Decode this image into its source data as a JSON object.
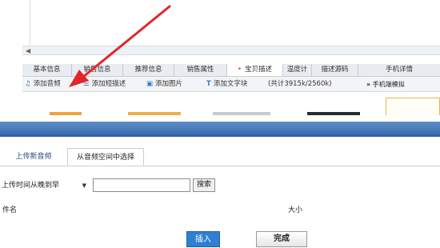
{
  "editor": {
    "tabs": [
      {
        "label": "基本信息",
        "required": false
      },
      {
        "label": "销售信息",
        "required": false
      },
      {
        "label": "推荐信息",
        "required": false
      },
      {
        "label": "销售属性",
        "required": false
      },
      {
        "label": "宝贝描述",
        "required": true
      },
      {
        "label": "温度计",
        "required": false
      },
      {
        "label": "描述源码",
        "required": false
      },
      {
        "label": "手机详情",
        "required": false
      }
    ],
    "toolbar": {
      "add_audio": "添加音频",
      "add_short_desc": "添加短描述",
      "add_image": "添加图片",
      "add_text": "添加文字块",
      "count": "(共计3915k/2560k)",
      "mobile_preview": "手机端模拟"
    },
    "icons": {
      "audio": "music-note-icon",
      "short_desc": "list-icon",
      "image": "image-icon",
      "text": "text-t-icon",
      "preview": "double-chevron-right-icon"
    },
    "colors": {
      "required_marker": "#e23c3c",
      "annotation_arrow": "#e0262b",
      "dialog_header": "#3a6fb0",
      "insert_button": "#2f7fd3"
    }
  },
  "dialog": {
    "tabs": {
      "upload": "上传新音频",
      "from_space": "从音频空间中选择"
    },
    "sort_select": "上传时间从晚到早",
    "search_value": "",
    "search_button": "搜索",
    "columns": {
      "name": "件名",
      "size": "大小"
    },
    "insert_button": "插入",
    "done_button": "完成"
  }
}
